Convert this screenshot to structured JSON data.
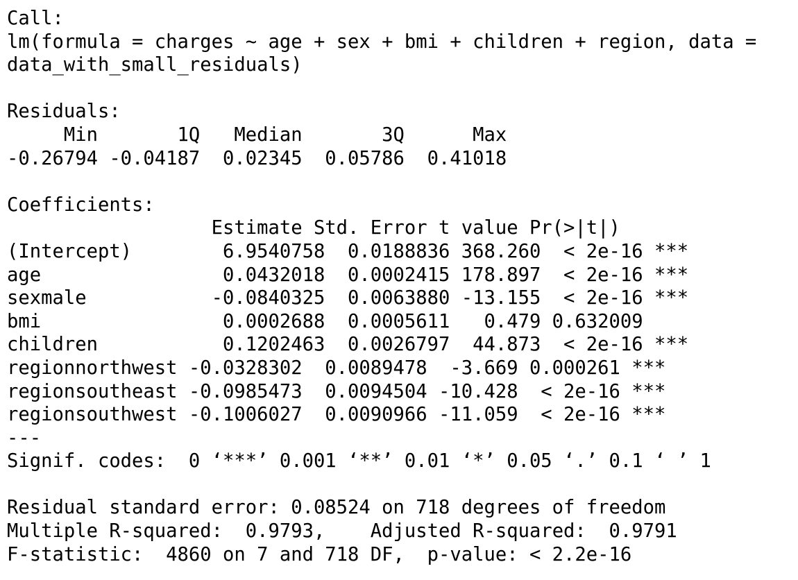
{
  "console_output": {
    "call_header": "Call:",
    "call_line_1": "lm(formula = charges ~ age + sex + bmi + children + region, data =",
    "call_line_2": "data_with_small_residuals)",
    "residuals_header": "Residuals:",
    "residuals_labels_line": "     Min       1Q   Median       3Q      Max ",
    "residuals_values_line": "-0.26794 -0.04187  0.02345  0.05786  0.41018 ",
    "residuals": {
      "labels": [
        "Min",
        "1Q",
        "Median",
        "3Q",
        "Max"
      ],
      "values": [
        "-0.26794",
        "-0.04187",
        "0.02345",
        "0.05786",
        "0.41018"
      ]
    },
    "coefficients_header": "Coefficients:",
    "coefficients_table_header": "                  Estimate Std. Error t value Pr(>|t|)    ",
    "coefficients_columns": [
      "Estimate",
      "Std. Error",
      "t value",
      "Pr(>|t|)"
    ],
    "coefficients_rows": [
      {
        "line": "(Intercept)        6.9540758  0.0188836 368.260  < 2e-16 ***",
        "term": "(Intercept)",
        "estimate": "6.9540758",
        "std_error": "0.0188836",
        "t_value": "368.260",
        "p_value": "< 2e-16",
        "signif": "***"
      },
      {
        "line": "age                0.0432018  0.0002415 178.897  < 2e-16 ***",
        "term": "age",
        "estimate": "0.0432018",
        "std_error": "0.0002415",
        "t_value": "178.897",
        "p_value": "< 2e-16",
        "signif": "***"
      },
      {
        "line": "sexmale           -0.0840325  0.0063880 -13.155  < 2e-16 ***",
        "term": "sexmale",
        "estimate": "-0.0840325",
        "std_error": "0.0063880",
        "t_value": "-13.155",
        "p_value": "< 2e-16",
        "signif": "***"
      },
      {
        "line": "bmi                0.0002688  0.0005611   0.479 0.632009    ",
        "term": "bmi",
        "estimate": "0.0002688",
        "std_error": "0.0005611",
        "t_value": "0.479",
        "p_value": "0.632009",
        "signif": ""
      },
      {
        "line": "children           0.1202463  0.0026797  44.873  < 2e-16 ***",
        "term": "children",
        "estimate": "0.1202463",
        "std_error": "0.0026797",
        "t_value": "44.873",
        "p_value": "< 2e-16",
        "signif": "***"
      },
      {
        "line": "regionnorthwest -0.0328302  0.0089478  -3.669 0.000261 ***",
        "term": "regionnorthwest",
        "estimate": "-0.0328302",
        "std_error": "0.0089478",
        "t_value": "-3.669",
        "p_value": "0.000261",
        "signif": "***"
      },
      {
        "line": "regionsoutheast -0.0985473  0.0094504 -10.428  < 2e-16 ***",
        "term": "regionsoutheast",
        "estimate": "-0.0985473",
        "std_error": "0.0094504",
        "t_value": "-10.428",
        "p_value": "< 2e-16",
        "signif": "***"
      },
      {
        "line": "regionsouthwest -0.1006027  0.0090966 -11.059  < 2e-16 ***",
        "term": "regionsouthwest",
        "estimate": "-0.1006027",
        "std_error": "0.0090966",
        "t_value": "-11.059",
        "p_value": "< 2e-16",
        "signif": "***"
      }
    ],
    "separator_line": "---",
    "signif_codes_line": "Signif. codes:  0 ‘***’ 0.001 ‘**’ 0.01 ‘*’ 0.05 ‘.’ 0.1 ‘ ’ 1",
    "residual_se_line": "Residual standard error: 0.08524 on 718 degrees of freedom",
    "r_squared_line": "Multiple R-squared:  0.9793,\tAdjusted R-squared:  0.9791 ",
    "f_statistic_line": "F-statistic:  4860 on 7 and 718 DF,  p-value: < 2.2e-16"
  }
}
